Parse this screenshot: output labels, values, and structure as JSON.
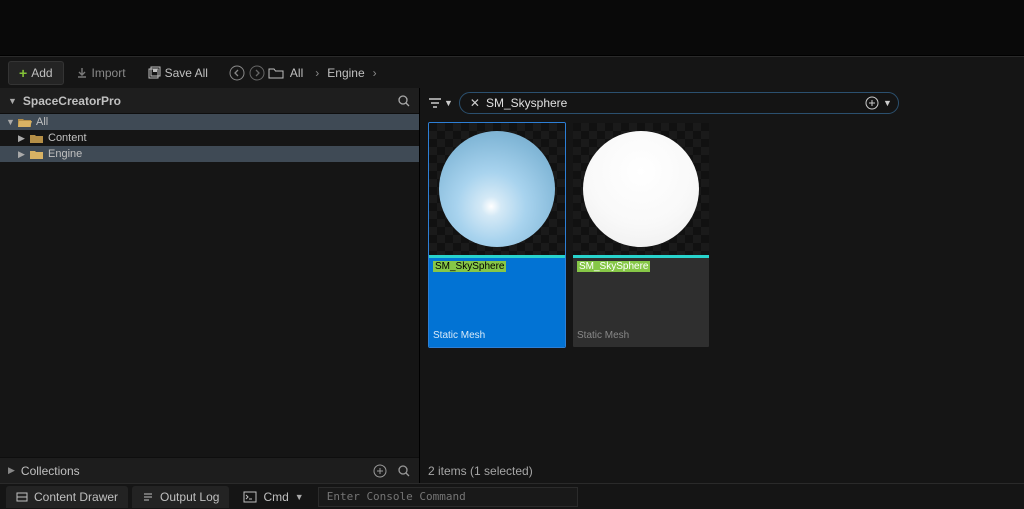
{
  "toolbar": {
    "add": "Add",
    "import": "Import",
    "save_all": "Save All",
    "breadcrumb": [
      "All",
      "Engine"
    ]
  },
  "sources": {
    "title": "SpaceCreatorPro",
    "tree": [
      {
        "label": "All",
        "depth": 0,
        "expanded": true,
        "open": true
      },
      {
        "label": "Content",
        "depth": 1,
        "expanded": false,
        "open": false
      },
      {
        "label": "Engine",
        "depth": 1,
        "expanded": false,
        "open": false,
        "selected": true
      }
    ],
    "collections": "Collections"
  },
  "search": {
    "value": "SM_Skysphere"
  },
  "assets": [
    {
      "name": "SM_SkySphere",
      "type": "Static Mesh",
      "selected": true,
      "variant": "blue"
    },
    {
      "name": "SM_SkySphere",
      "type": "Static Mesh",
      "selected": false,
      "variant": "white"
    }
  ],
  "status": "2 items (1 selected)",
  "bottom": {
    "content_drawer": "Content Drawer",
    "output_log": "Output Log",
    "cmd": "Cmd",
    "console_placeholder": "Enter Console Command"
  }
}
